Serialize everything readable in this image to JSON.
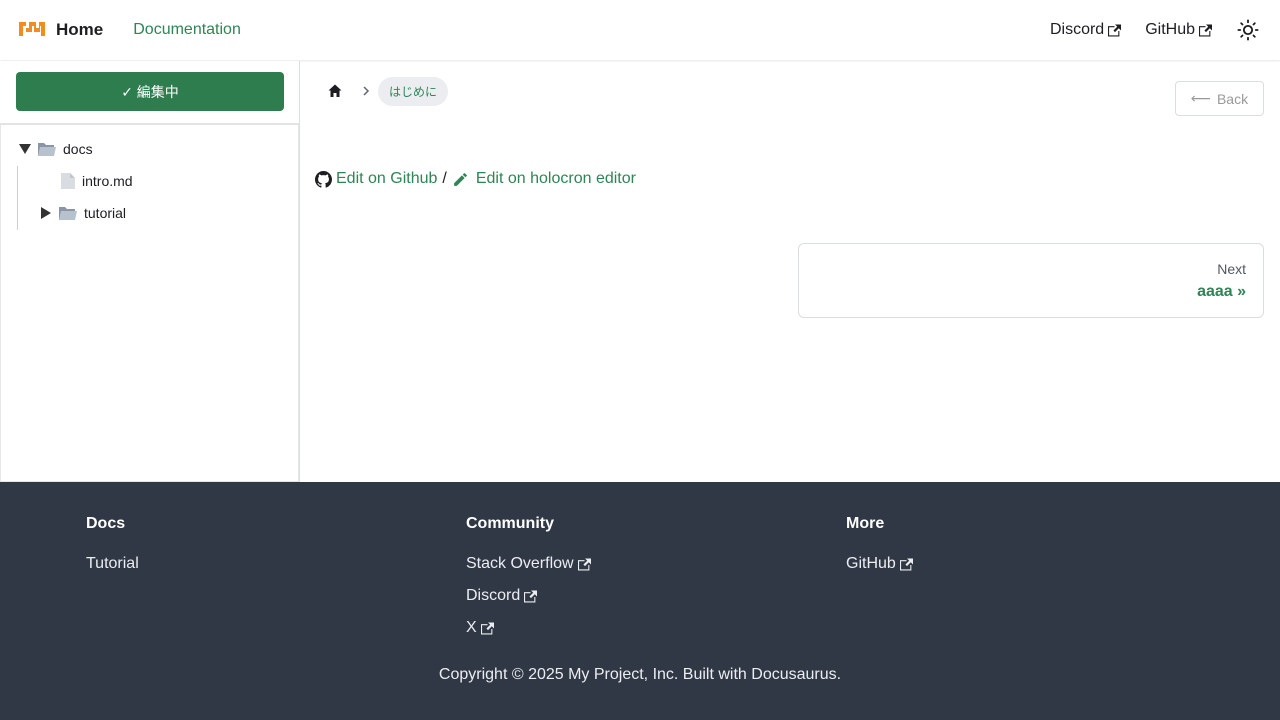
{
  "navbar": {
    "title": "Home",
    "docs_link": "Documentation",
    "discord": "Discord",
    "github": "GitHub"
  },
  "sidebar": {
    "edit_button": "✓ 編集中",
    "tree": {
      "root": "docs",
      "file": "intro.md",
      "folder": "tutorial"
    }
  },
  "main": {
    "breadcrumb": "はじめに",
    "back_label": "Back",
    "edit_github": "Edit on Github",
    "slash": "/",
    "edit_holocron": "Edit on holocron editor",
    "next_sub": "Next",
    "next_title": "aaaa »"
  },
  "footer": {
    "docs": {
      "title": "Docs",
      "items": [
        "Tutorial"
      ]
    },
    "community": {
      "title": "Community",
      "items": [
        "Stack Overflow",
        "Discord",
        "X"
      ]
    },
    "more": {
      "title": "More",
      "items": [
        "GitHub"
      ]
    },
    "copyright": "Copyright © 2025 My Project, Inc. Built with Docusaurus."
  },
  "colors": {
    "accent": "#2e8555",
    "edit_button": "#2e7d4f",
    "footer_bg": "#303846",
    "logo": "#f28c1e"
  }
}
